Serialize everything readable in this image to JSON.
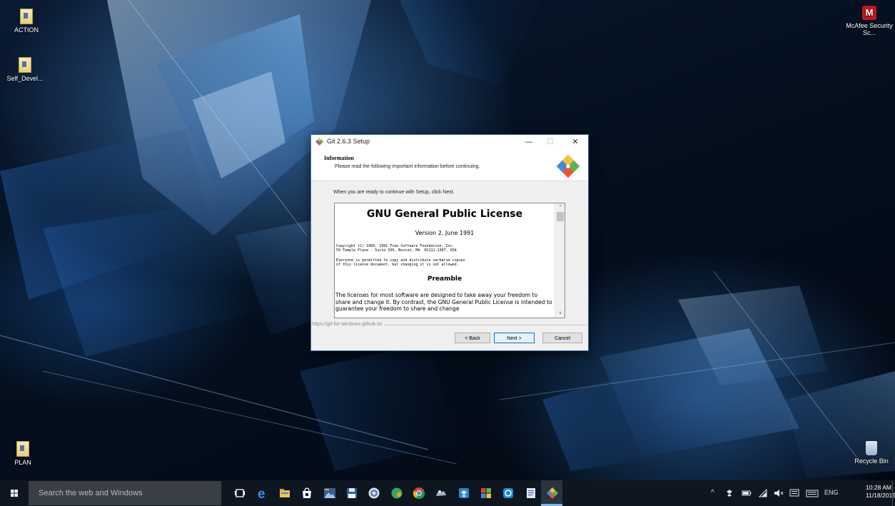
{
  "desktop": {
    "icons_left": [
      {
        "label": "ACTION",
        "icon": "folder-file-icon"
      },
      {
        "label": "Self_Devel...",
        "icon": "folder-file-icon"
      },
      {
        "label": "PLAN",
        "icon": "folder-file-icon"
      }
    ],
    "icons_right": [
      {
        "label": "McAfee Security Sc...",
        "icon": "mcafee-icon"
      },
      {
        "label": "Recycle Bin",
        "icon": "recycle-bin-icon"
      }
    ]
  },
  "setup_window": {
    "title": "Git 2.6.3 Setup",
    "controls": {
      "minimize": "—",
      "maximize": "☐",
      "close": "✕"
    },
    "header": {
      "heading": "Information",
      "subheading": "Please read the following important information before continuing."
    },
    "instruction": "When you are ready to continue with Setup, click Next.",
    "license": {
      "title": "GNU General Public License",
      "version": "Version 2, June 1991",
      "copyright_line1": "Copyright (C) 1989, 1991 Free Software Foundation, Inc.",
      "copyright_line2": "59 Temple Place - Suite 330, Boston, MA  02111-1307, USA",
      "notice_line1": "Everyone is permitted to copy and distribute verbatim copies",
      "notice_line2": "of this license document, but changing it is not allowed.",
      "preamble_title": "Preamble",
      "preamble_text": "The licenses for most software are designed to take away your freedom to share and change it. By contrast, the GNU General Public License is intended to guarantee your freedom to share and change"
    },
    "scroll_up": "^",
    "scroll_down": "v",
    "url": "https://git-for-windows.github.io/",
    "buttons": {
      "back": "< Back",
      "next": "Next >",
      "cancel": "Cancel"
    }
  },
  "taskbar": {
    "search_placeholder": "Search the web and Windows",
    "apps": [
      "task-view-icon",
      "edge-icon",
      "file-explorer-icon",
      "store-icon",
      "photo-app-icon",
      "save-disk-icon",
      "browser-circle-icon",
      "green-phone-icon",
      "chrome-icon",
      "pictures-icon",
      "dropbox-icon",
      "color-tiles-icon",
      "blue-app-icon",
      "document-icon",
      "git-icon"
    ],
    "tray": {
      "chevron": "^",
      "language": "ENG",
      "time": "10:28 AM",
      "date": "11/18/2015"
    }
  },
  "colors": {
    "accent": "#0078d7",
    "taskbar": "#0e1620",
    "window_border": "#3c6fae",
    "git_orange": "#f05133"
  }
}
